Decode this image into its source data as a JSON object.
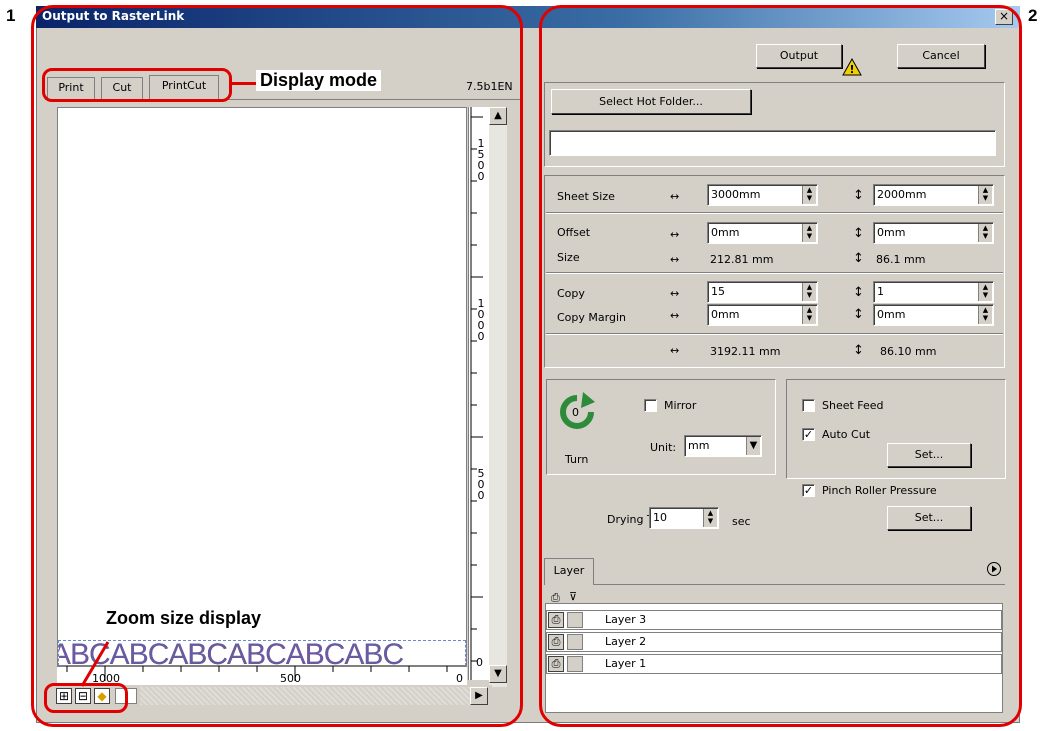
{
  "window": {
    "title": "Output to RasterLink",
    "close_glyph": "×"
  },
  "callouts": {
    "num_left": "1",
    "num_right": "2",
    "display_mode": "Display mode",
    "zoom_size": "Zoom size display"
  },
  "left": {
    "tabs": [
      {
        "label": "Print"
      },
      {
        "label": "Cut"
      },
      {
        "label": "PrintCut"
      }
    ],
    "version": "7.5b1EN",
    "ruler_v": [
      "1500",
      "1000",
      "500"
    ],
    "ruler_h": [
      "1000",
      "500",
      "0"
    ],
    "ruler_zero_v": "0",
    "preview_text": "ABCABCABCABCABCABC"
  },
  "right": {
    "output_label": "Output",
    "cancel_label": "Cancel",
    "select_hot_folder_label": "Select Hot Folder...",
    "hot_folder_value": "",
    "sheet_size": {
      "label": "Sheet Size",
      "width": "3000mm",
      "height": "2000mm"
    },
    "offset": {
      "label": "Offset",
      "x": "0mm",
      "y": "0mm"
    },
    "size": {
      "label": "Size",
      "width": "212.81 mm",
      "height": "86.1 mm"
    },
    "copy": {
      "label": "Copy",
      "x": "15",
      "y": "1"
    },
    "copy_margin": {
      "label": "Copy Margin",
      "x": "0mm",
      "y": "0mm"
    },
    "total": {
      "width": "3192.11 mm",
      "height": "86.10 mm"
    },
    "turn_label": "Turn",
    "turn_value": "0",
    "mirror_label": "Mirror",
    "unit_label": "Unit:",
    "unit_value": "mm",
    "sheet_feed_label": "Sheet Feed",
    "auto_cut_label": "Auto Cut",
    "set_label": "Set...",
    "pinch_roller_label": "Pinch Roller Pressure",
    "drying_time_label": "Drying Time",
    "drying_time_value": "10",
    "drying_unit": "sec",
    "layer_tab": "Layer",
    "layers": [
      "Layer 3",
      "Layer 2",
      "Layer 1"
    ]
  },
  "colors": {
    "accent_red": "#e00000",
    "title_blue": "#0a246a",
    "turn_green": "#2e8b3a",
    "letters_purple": "#a0409a",
    "letters_blue": "#5a7fbf"
  }
}
